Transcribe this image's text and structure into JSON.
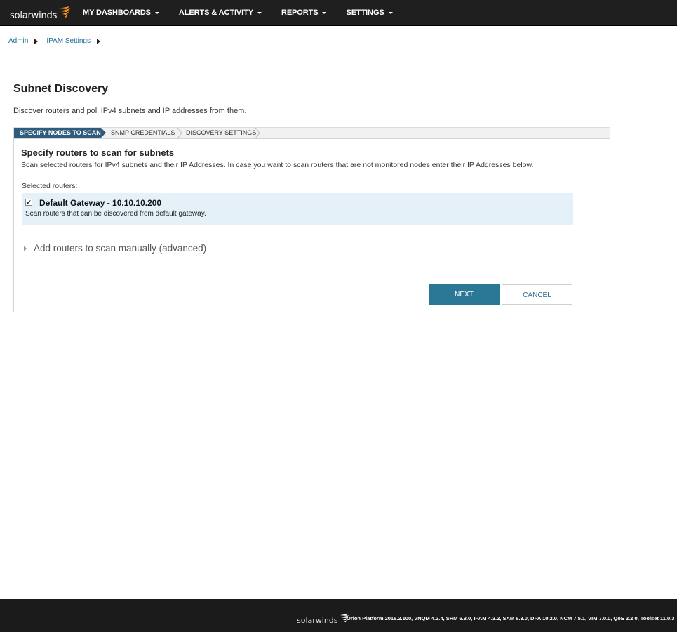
{
  "brand": {
    "name": "solarwinds",
    "accent": "#f7941d"
  },
  "nav": {
    "items": [
      {
        "label": "MY DASHBOARDS"
      },
      {
        "label": "ALERTS & ACTIVITY"
      },
      {
        "label": "REPORTS"
      },
      {
        "label": "SETTINGS"
      }
    ]
  },
  "breadcrumb": {
    "items": [
      {
        "label": "Admin"
      },
      {
        "label": "IPAM Settings"
      }
    ]
  },
  "page": {
    "title": "Subnet Discovery",
    "description": "Discover routers and poll IPv4 subnets and IP addresses from them."
  },
  "wizard": {
    "steps": [
      {
        "label": "SPECIFY NODES TO SCAN",
        "active": true
      },
      {
        "label": "SNMP CREDENTIALS",
        "active": false
      },
      {
        "label": "DISCOVERY SETTINGS",
        "active": false
      }
    ]
  },
  "panel": {
    "title": "Specify routers to scan for subnets",
    "description": "Scan selected routers for IPv4 subnets and their IP Addresses. In case you want to scan routers that are not monitored nodes enter their IP Addresses below.",
    "selected_label": "Selected routers:",
    "router": {
      "checked": true,
      "title": "Default Gateway - 10.10.10.200",
      "subtitle": "Scan routers that can be discovered from default gateway."
    },
    "advanced_label": "Add routers to scan manually (advanced)",
    "next_label": "NEXT",
    "cancel_label": "CANCEL"
  },
  "footer": {
    "brand": "solarwinds",
    "versions": "Orion Platform 2016.2.100, VNQM 4.2.4, SRM 6.3.0, IPAM 4.3.2, SAM 6.3.0, DPA 10.2.0, NCM 7.5.1, VIM 7.0.0, QoE 2.2.0, Toolset 11.0.3"
  }
}
